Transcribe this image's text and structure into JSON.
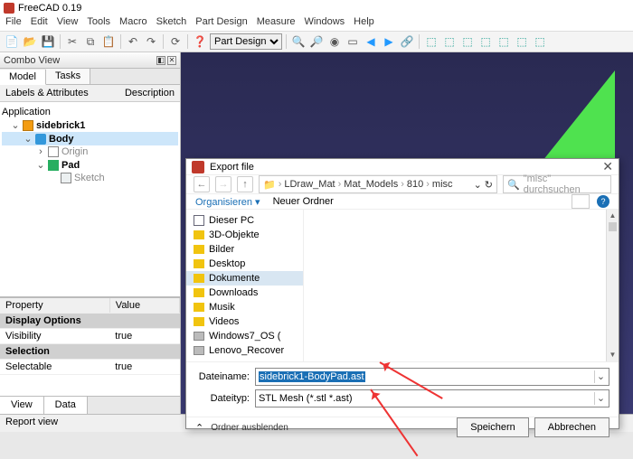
{
  "app": {
    "title": "FreeCAD 0.19"
  },
  "menu": [
    "File",
    "Edit",
    "View",
    "Tools",
    "Macro",
    "Sketch",
    "Part Design",
    "Measure",
    "Windows",
    "Help"
  ],
  "workbench": "Part Design",
  "combo": {
    "title": "Combo View",
    "tabs": [
      "Model",
      "Tasks"
    ],
    "la_labels": "Labels & Attributes",
    "la_desc": "Description",
    "app_label": "Application",
    "tree": {
      "doc": "sidebrick1",
      "body": "Body",
      "origin": "Origin",
      "pad": "Pad",
      "sketch": "Sketch"
    },
    "props": {
      "col_property": "Property",
      "col_value": "Value",
      "grp_display": "Display Options",
      "visibility_k": "Visibility",
      "visibility_v": "true",
      "grp_selection": "Selection",
      "selectable_k": "Selectable",
      "selectable_v": "true"
    },
    "bottom_tabs": [
      "View",
      "Data"
    ]
  },
  "report": "Report view",
  "dialog": {
    "title": "Export file",
    "crumbs": [
      "LDraw_Mat",
      "Mat_Models",
      "810",
      "misc"
    ],
    "search_placeholder": "\"misc\" durchsuchen",
    "organize": "Organisieren",
    "new_folder": "Neuer Ordner",
    "sidebar": [
      "Dieser PC",
      "3D-Objekte",
      "Bilder",
      "Desktop",
      "Dokumente",
      "Downloads",
      "Musik",
      "Videos",
      "Windows7_OS (",
      "Lenovo_Recover"
    ],
    "sidebar_selected_index": 4,
    "filename_label": "Dateiname:",
    "filename_value": "sidebrick1-BodyPad.ast",
    "filetype_label": "Dateityp:",
    "filetype_value": "STL Mesh (*.stl *.ast)",
    "hide_folders": "Ordner ausblenden",
    "save": "Speichern",
    "cancel": "Abbrechen"
  }
}
